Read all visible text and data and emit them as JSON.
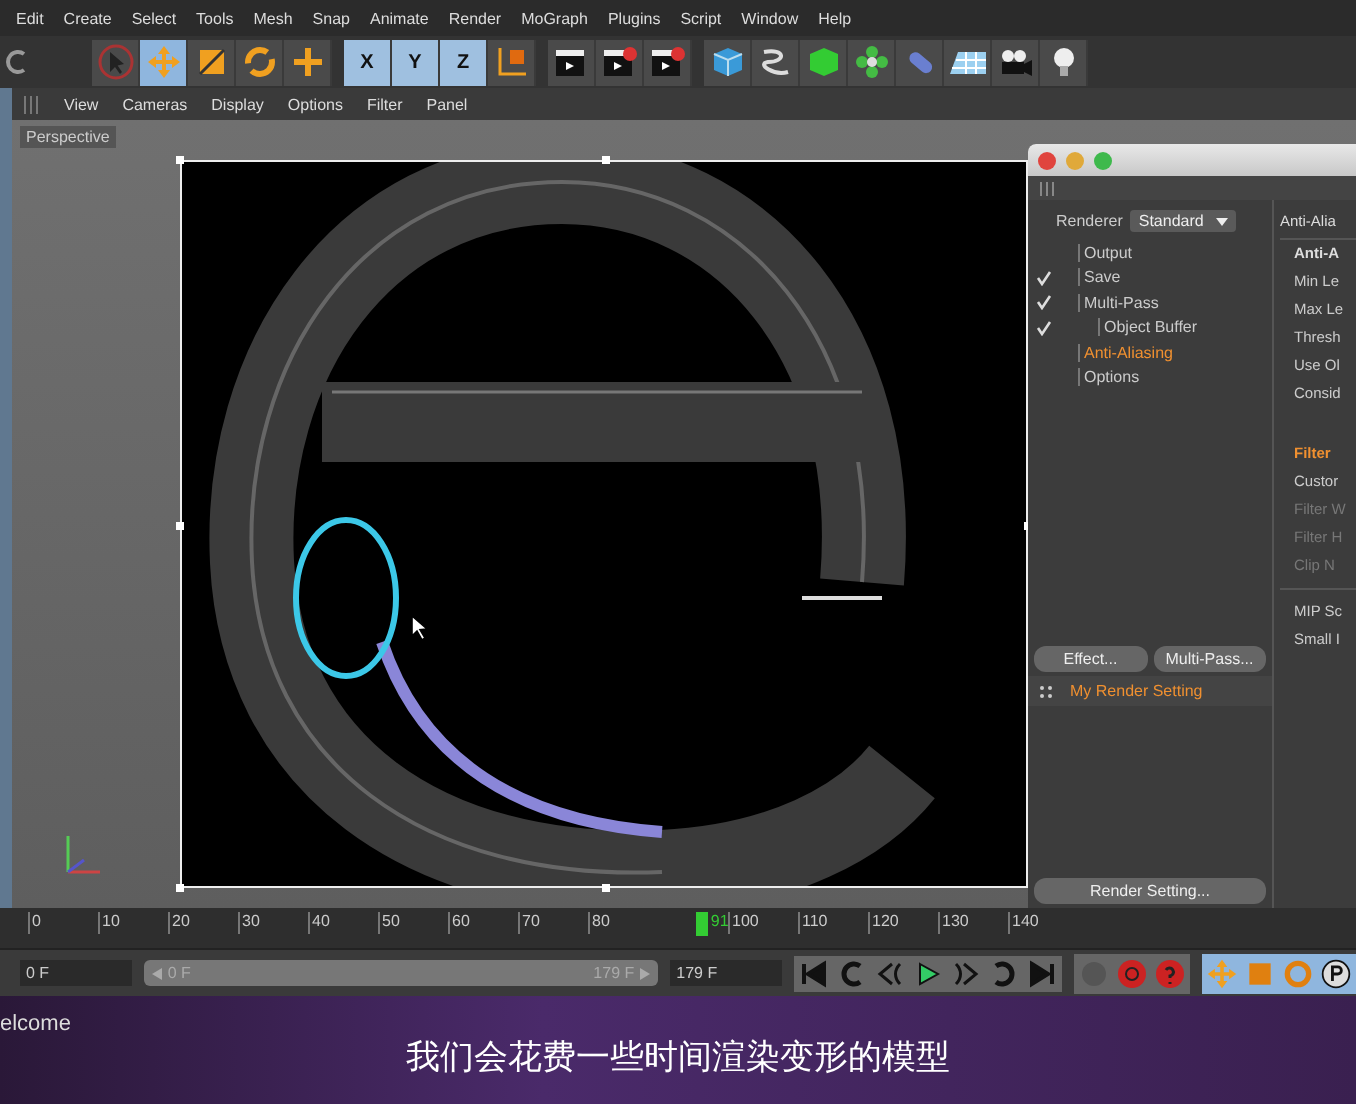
{
  "menu_bar": {
    "items": [
      "Edit",
      "Create",
      "Select",
      "Tools",
      "Mesh",
      "Snap",
      "Animate",
      "Render",
      "MoGraph",
      "Plugins",
      "Script",
      "Window",
      "Help"
    ]
  },
  "toolbar": {
    "tools": [
      {
        "kind": "select",
        "selected": false
      },
      {
        "kind": "move",
        "selected": true
      },
      {
        "kind": "scale",
        "selected": false
      },
      {
        "kind": "rotate",
        "selected": false
      },
      {
        "kind": "add",
        "selected": false
      }
    ],
    "axes": [
      {
        "label": "X",
        "selected": true
      },
      {
        "label": "Y",
        "selected": true
      },
      {
        "label": "Z",
        "selected": true
      }
    ]
  },
  "viewport": {
    "menu": [
      "View",
      "Cameras",
      "Display",
      "Options",
      "Filter",
      "Panel"
    ],
    "label": "Perspective"
  },
  "render_settings": {
    "renderer_label": "Renderer",
    "renderer": "Standard",
    "tree": [
      {
        "label": "Output",
        "checked": false,
        "selected": false
      },
      {
        "label": "Save",
        "checked": true,
        "selected": false
      },
      {
        "label": "Multi-Pass",
        "checked": true,
        "selected": false,
        "children": [
          {
            "label": "Object Buffer",
            "checked": true,
            "selected": false
          }
        ]
      },
      {
        "label": "Anti-Aliasing",
        "checked": false,
        "selected": true
      },
      {
        "label": "Options",
        "checked": false,
        "selected": false
      }
    ],
    "buttons": [
      "Effect...",
      "Multi-Pass..."
    ],
    "settings_list": [
      {
        "label": "My Render Setting",
        "selected": true
      }
    ],
    "bottom_button": "Render Setting...",
    "panel_title": "Anti-Alia",
    "params": [
      {
        "label": "Anti-A",
        "kind": "header",
        "disabled": false
      },
      {
        "label": "Min Le",
        "kind": "param",
        "disabled": false
      },
      {
        "label": "Max Le",
        "kind": "param",
        "disabled": false
      },
      {
        "label": "Thresh",
        "kind": "param",
        "disabled": false
      },
      {
        "label": "Use Ol",
        "kind": "param",
        "disabled": false
      },
      {
        "label": "Consid",
        "kind": "param",
        "disabled": false
      },
      {
        "label": "Filter",
        "kind": "section",
        "disabled": false
      },
      {
        "label": "Custor",
        "kind": "param",
        "disabled": false
      },
      {
        "label": "Filter W",
        "kind": "param",
        "disabled": true
      },
      {
        "label": "Filter H",
        "kind": "param",
        "disabled": true
      },
      {
        "label": "Clip N",
        "kind": "param",
        "disabled": true
      },
      {
        "label": "MIP Sc",
        "kind": "divided",
        "disabled": false
      },
      {
        "label": "Small I",
        "kind": "param",
        "disabled": false
      }
    ]
  },
  "timeline": {
    "ticks": [
      "0",
      "10",
      "20",
      "30",
      "40",
      "50",
      "60",
      "70",
      "80",
      "100",
      "110",
      "120",
      "130",
      "140"
    ],
    "current_frame": "91",
    "level": 0.508
  },
  "transport": {
    "start_field": "0 F",
    "range_start": "0 F",
    "range_end": "179 F",
    "end_field": "179 F"
  },
  "footer": {
    "side_text": "elcome",
    "subtitle": "我们会花费一些时间渲染变形的模型"
  }
}
